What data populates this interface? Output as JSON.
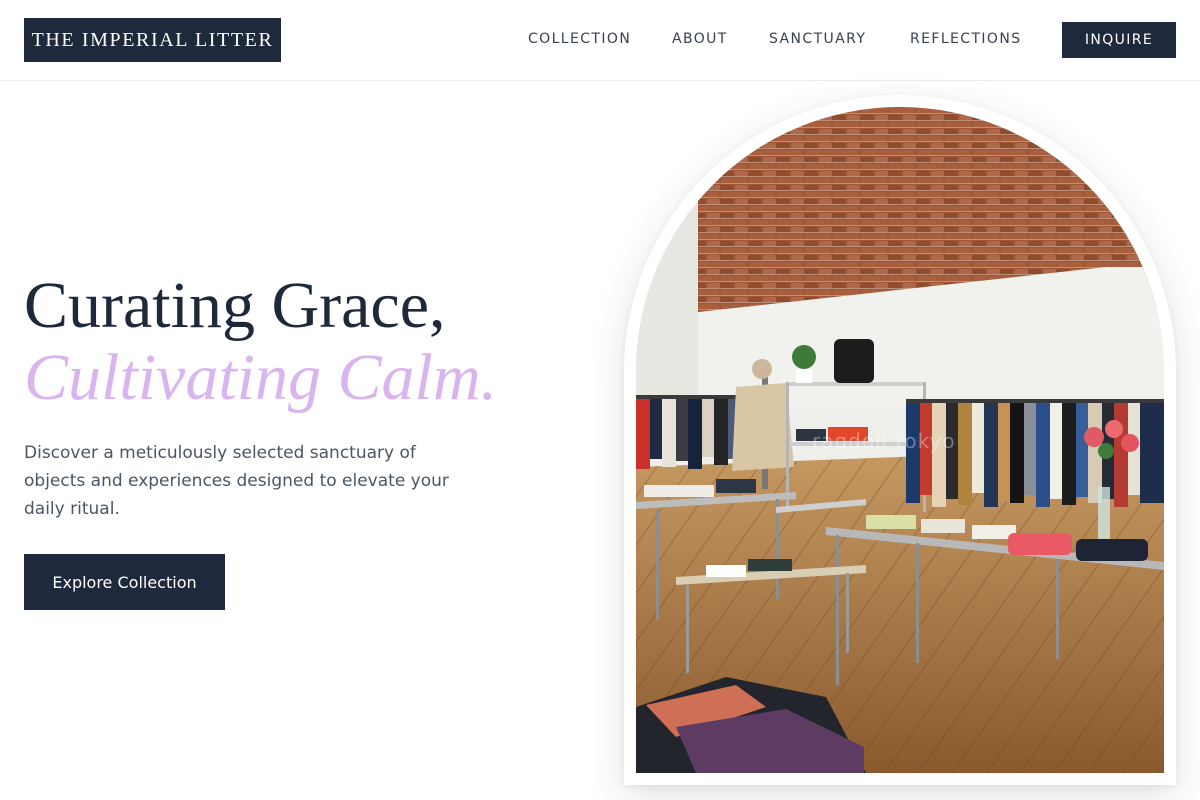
{
  "brand": {
    "logo_text": "THE IMPERIAL LITTER"
  },
  "nav": {
    "items": [
      {
        "label": "COLLECTION"
      },
      {
        "label": "ABOUT"
      },
      {
        "label": "SANCTUARY"
      },
      {
        "label": "REFLECTIONS"
      }
    ],
    "inquire_label": "INQUIRE"
  },
  "hero": {
    "heading_line1": "Curating Grace,",
    "heading_line2": "Cultivating Calm.",
    "description": "Discover a meticulously selected sanctuary of objects and experiences designed to elevate your daily ritual.",
    "cta_label": "Explore Collection",
    "image_watermark": "ragdoll tokyo"
  },
  "colors": {
    "primary": "#1e293b",
    "accent_lilac": "#dab4ef",
    "text_muted": "#4b5563",
    "background": "#ffffff"
  }
}
